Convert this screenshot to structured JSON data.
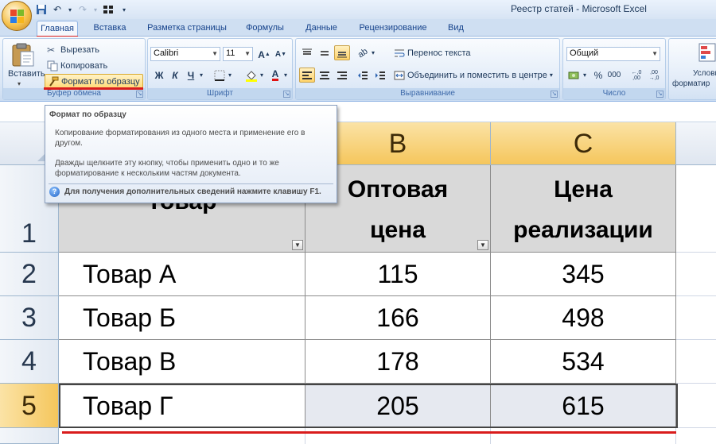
{
  "window": {
    "title": "Реестр статей - Microsoft Excel"
  },
  "tabs": [
    "Главная",
    "Вставка",
    "Разметка страницы",
    "Формулы",
    "Данные",
    "Рецензирование",
    "Вид"
  ],
  "ribbon": {
    "clipboard": {
      "paste_label": "Вставить",
      "cut_label": "Вырезать",
      "copy_label": "Копировать",
      "format_painter_label": "Формат по образцу",
      "group_label": "Буфер обмена"
    },
    "font": {
      "font_name": "Calibri",
      "font_size": "11",
      "bold": "Ж",
      "italic": "К",
      "underline": "Ч",
      "group_label": "Шрифт"
    },
    "alignment": {
      "wrap_text_label": "Перенос текста",
      "merge_label": "Объединить и поместить в центре",
      "group_label": "Выравнивание"
    },
    "number": {
      "format": "Общий",
      "percent": "%",
      "thousands": "000",
      "group_label": "Число"
    },
    "styles": {
      "partial_label": "Услови",
      "partial_label2": "форматир"
    }
  },
  "tooltip": {
    "title": "Формат по образцу",
    "paragraph1": "Копирование форматирования из одного места и применение его в другом.",
    "paragraph2": "Дважды щелкните эту кнопку, чтобы применить одно и то же форматирование к нескольким частям документа.",
    "help_text": "Для получения дополнительных сведений нажмите клавишу F1."
  },
  "sheet": {
    "columns": [
      "B",
      "C"
    ],
    "rows": [
      "1",
      "2",
      "3",
      "4",
      "5"
    ],
    "header": {
      "a": "Товар",
      "b": "Оптовая цена",
      "b1": "Оптовая",
      "b2": "цена",
      "c1": "Цена",
      "c2": "реализации"
    },
    "data": [
      {
        "name": "Товар А",
        "wholesale": "115",
        "retail": "345"
      },
      {
        "name": "Товар Б",
        "wholesale": "166",
        "retail": "498"
      },
      {
        "name": "Товар В",
        "wholesale": "178",
        "retail": "534"
      },
      {
        "name": "Товар Г",
        "wholesale": "205",
        "retail": "615"
      }
    ]
  },
  "colors": {
    "accent": "#d91c1c",
    "selection": "#f5c65c",
    "ribbon": "#dbe7f6"
  }
}
